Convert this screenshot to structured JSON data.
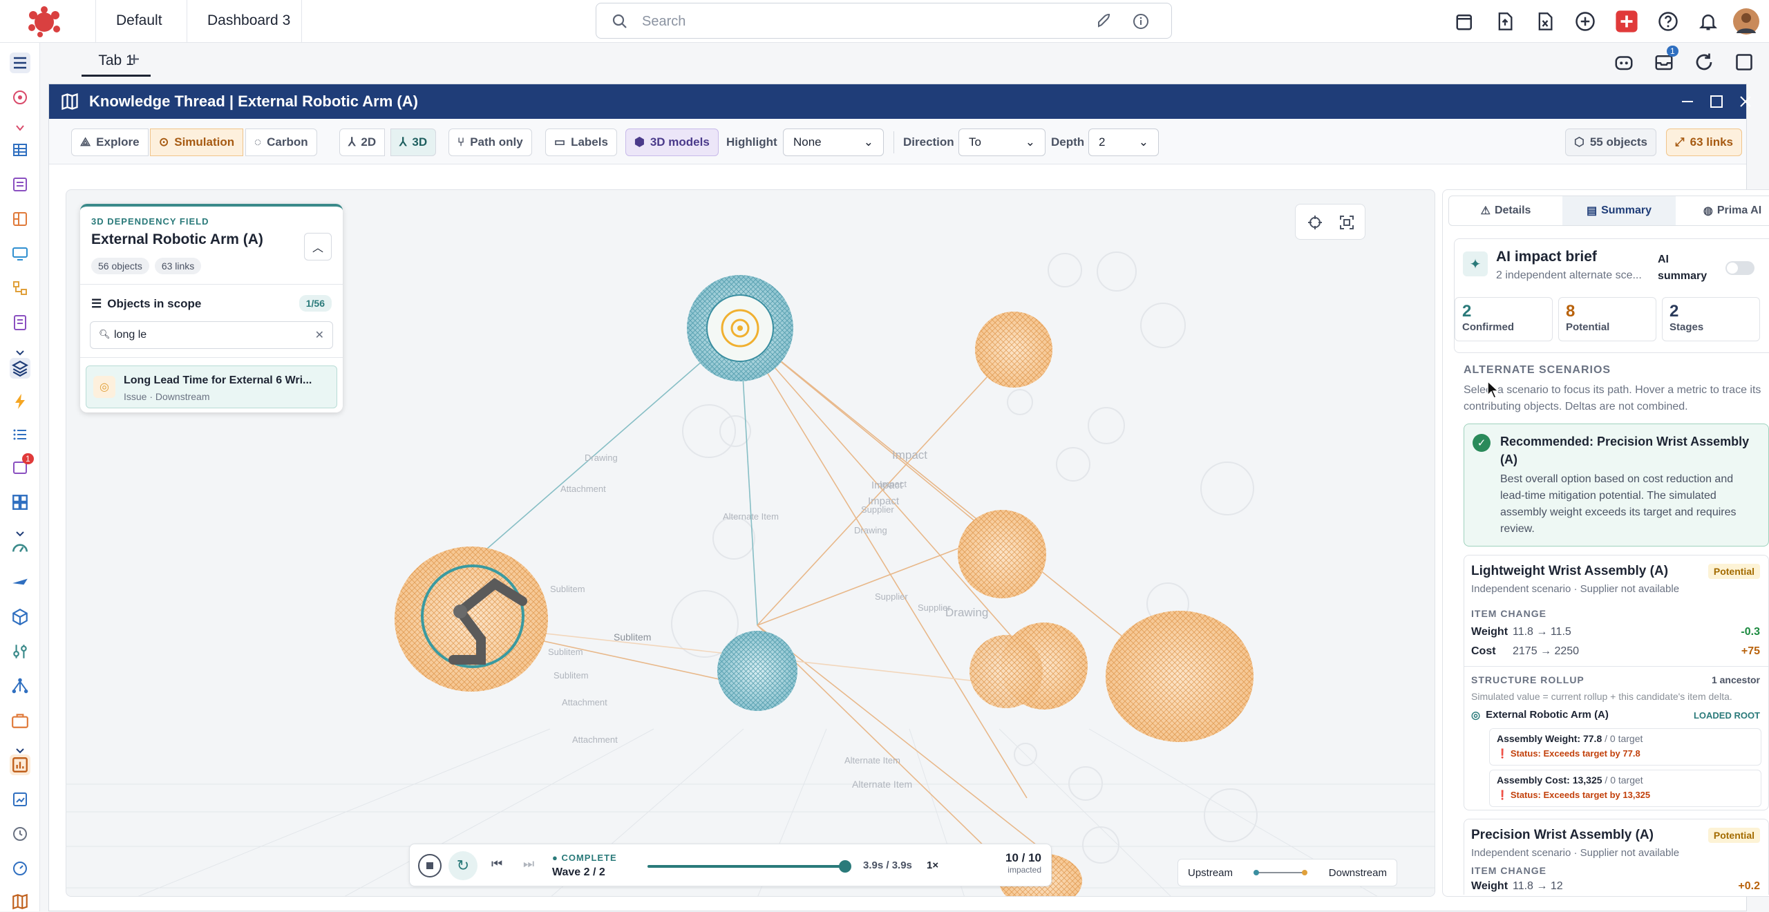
{
  "topbar": {
    "workspace": "Default",
    "dashboard": "Dashboard 3",
    "search_placeholder": "Search",
    "notification_count": "1"
  },
  "tabs": {
    "tab1": "Tab 1",
    "add": "+"
  },
  "rail": {
    "badge": "1"
  },
  "window": {
    "title": "Knowledge Thread | External Robotic Arm (A)"
  },
  "toolbar": {
    "explore": "Explore",
    "simulation": "Simulation",
    "carbon": "Carbon",
    "view2d": "2D",
    "view3d": "3D",
    "path_only": "Path only",
    "labels": "Labels",
    "models3d": "3D models",
    "highlight_label": "Highlight",
    "highlight_value": "None",
    "direction_label": "Direction",
    "direction_value": "To",
    "depth_label": "Depth",
    "depth_value": "2",
    "objects_count": "55 objects",
    "links_count": "63 links"
  },
  "scope": {
    "kicker": "3D DEPENDENCY FIELD",
    "title": "External Robotic Arm (A)",
    "objects": "56 objects",
    "links": "63 links",
    "section": "Objects in scope",
    "count": "1/56",
    "search_value": "long le",
    "result_title": "Long Lead Time for External 6 Wri...",
    "result_sub": "Issue · Downstream"
  },
  "graph_labels": [
    "Drawing",
    "Impact",
    "Attachment",
    "Sublitem",
    "Alternate Item",
    "Supplier",
    "Drawing",
    "Impact",
    "Impact",
    "Drawing",
    "Supplier",
    "Supplier",
    "Alternate Item",
    "Alternate Item",
    "Sublitem",
    "Sublitem",
    "Attachment",
    "Impact",
    "Attachment",
    "Sublitem"
  ],
  "playback": {
    "status": "COMPLETE",
    "wave": "Wave 2 / 2",
    "time": "3.9s / 3.9s",
    "speed": "1×",
    "impacted_count": "10 / 10",
    "impacted_label": "impacted",
    "progress": 1.0
  },
  "legend": {
    "upstream": "Upstream",
    "downstream": "Downstream"
  },
  "panel": {
    "tabs": [
      "Details",
      "Summary",
      "Prima AI"
    ],
    "brief_title": "AI impact brief",
    "brief_sub": "2 independent alternate sce...",
    "ai_summary": "AI summary",
    "stats": [
      {
        "value": "2",
        "label": "Confirmed"
      },
      {
        "value": "8",
        "label": "Potential"
      },
      {
        "value": "2",
        "label": "Stages"
      }
    ],
    "alt_heading": "ALTERNATE SCENARIOS",
    "alt_desc": "Select a scenario to focus its path. Hover a metric to trace its contributing objects. Deltas are not combined.",
    "recommended_title": "Recommended: Precision Wrist Assembly (A)",
    "recommended_body": "Best overall option based on cost reduction and lead-time mitigation potential. The simulated assembly weight exceeds its target and requires review.",
    "scenario1": {
      "title": "Lightweight Wrist Assembly (A)",
      "badge": "Potential",
      "sub": "Independent scenario · Supplier not available",
      "item_change": "ITEM CHANGE",
      "weight_label": "Weight",
      "weight_range": "11.8 → 11.5",
      "weight_delta": "-0.3",
      "cost_label": "Cost",
      "cost_range": "2175 → 2250",
      "cost_delta": "+75",
      "rollup": "STRUCTURE ROLLUP",
      "ancestor": "1 ancestor",
      "rollup_note": "Simulated value = current rollup + this candidate's item delta.",
      "root_name": "External Robotic Arm (A)",
      "root_tag": "LOADED ROOT",
      "aw_label": "Assembly Weight: 77.8",
      "aw_target": "/ 0 target",
      "aw_status": "Status: Exceeds target by 77.8",
      "ac_label": "Assembly Cost: 13,325",
      "ac_target": "/ 0 target",
      "ac_status": "Status: Exceeds target by 13,325"
    },
    "scenario2": {
      "title": "Precision Wrist Assembly (A)",
      "badge": "Potential",
      "sub": "Independent scenario · Supplier not available",
      "item_change": "ITEM CHANGE",
      "weight_label": "Weight",
      "weight_range": "11.8 → 12",
      "weight_delta": "+0.2"
    }
  }
}
